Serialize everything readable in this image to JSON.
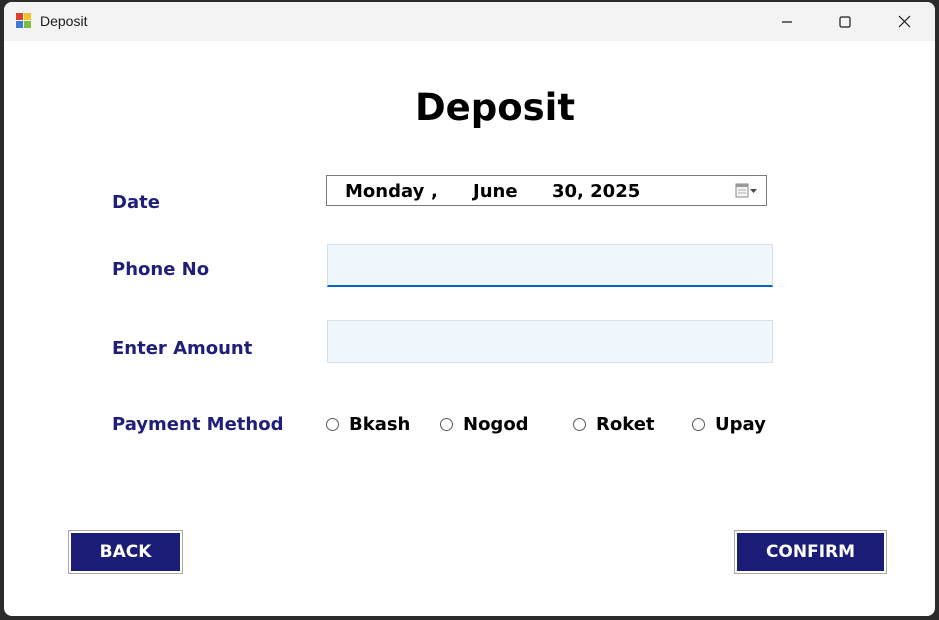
{
  "window": {
    "title": "Deposit"
  },
  "form": {
    "heading": "Deposit",
    "date_label": "Date",
    "date": {
      "weekday": "Monday",
      "sep1": ",",
      "month": "June",
      "day_year": "30, 2025"
    },
    "phone_label": "Phone No",
    "phone_value": "",
    "amount_label": "Enter Amount",
    "amount_value": "",
    "payment_label": "Payment Method",
    "payment_options": [
      "Bkash",
      "Nogod",
      "Roket",
      "Upay"
    ],
    "selected_payment": null
  },
  "buttons": {
    "back": "BACK",
    "confirm": "CONFIRM"
  },
  "colors": {
    "label": "#1f1f7a",
    "button_bg": "#1b1b78",
    "input_bg": "#eff6fc",
    "focus_underline": "#0067c0"
  }
}
